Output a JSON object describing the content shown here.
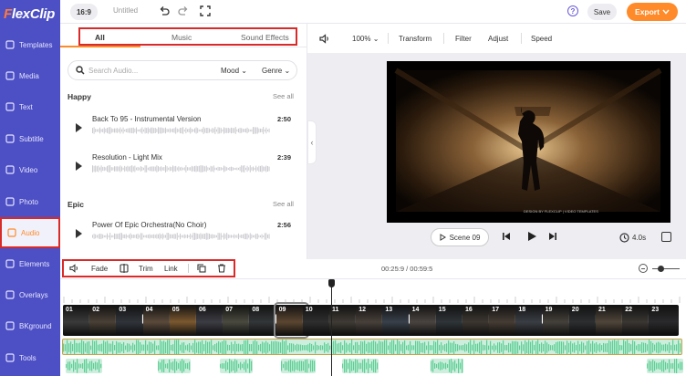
{
  "app": {
    "logo_prefix": "F",
    "logo_text": "lexClip",
    "aspect_ratio": "16:9",
    "title": "Untitled",
    "help": "?",
    "save_label": "Save",
    "export_label": "Export",
    "accent_color": "#ff8a2a",
    "sidebar_color": "#4d4fc4"
  },
  "sidebar": {
    "items": [
      {
        "label": "Templates",
        "icon": "templates-icon"
      },
      {
        "label": "Media",
        "icon": "media-icon"
      },
      {
        "label": "Text",
        "icon": "text-icon"
      },
      {
        "label": "Subtitle",
        "icon": "subtitle-icon"
      },
      {
        "label": "Video",
        "icon": "video-icon"
      },
      {
        "label": "Photo",
        "icon": "photo-icon"
      },
      {
        "label": "Audio",
        "icon": "music-note-icon",
        "active": true
      },
      {
        "label": "Elements",
        "icon": "elements-icon"
      },
      {
        "label": "Overlays",
        "icon": "overlays-icon"
      },
      {
        "label": "BKground",
        "icon": "background-icon"
      },
      {
        "label": "Tools",
        "icon": "tools-icon"
      }
    ]
  },
  "audio_panel": {
    "tabs": [
      "All",
      "Music",
      "Sound Effects"
    ],
    "active_tab": "All",
    "search_placeholder": "Search Audio...",
    "filters": [
      "Mood",
      "Genre"
    ],
    "sections": [
      {
        "title": "Happy",
        "see_all": "See all",
        "tracks": [
          {
            "name": "Back To 95 - Instrumental Version",
            "duration": "2:50"
          },
          {
            "name": "Resolution - Light Mix",
            "duration": "2:39"
          }
        ]
      },
      {
        "title": "Epic",
        "see_all": "See all",
        "tracks": [
          {
            "name": "Power Of Epic Orchestra(No Choir)",
            "duration": "2:56"
          }
        ]
      }
    ]
  },
  "preview_toolbar": {
    "zoom": "100%",
    "items": [
      "Transform",
      "Filter",
      "Adjust",
      "Speed"
    ]
  },
  "preview": {
    "scene_label": "Scene 09",
    "duration": "4.0s",
    "watermark": "DESIGN BY FLEXCLIP | VIDEO TEMPLATES"
  },
  "timeline_toolbar": {
    "fade_label": "Fade",
    "trim_label": "Trim",
    "link_label": "Link"
  },
  "timeline": {
    "timecode": "00:25:9 / 00:59:5",
    "zoom_level": 0.3,
    "scenes": [
      "01",
      "02",
      "03",
      "04",
      "05",
      "06",
      "07",
      "08",
      "09",
      "10",
      "11",
      "12",
      "13",
      "14",
      "15",
      "16",
      "17",
      "18",
      "19",
      "20",
      "21",
      "22",
      "23"
    ],
    "current_scene": "09"
  }
}
